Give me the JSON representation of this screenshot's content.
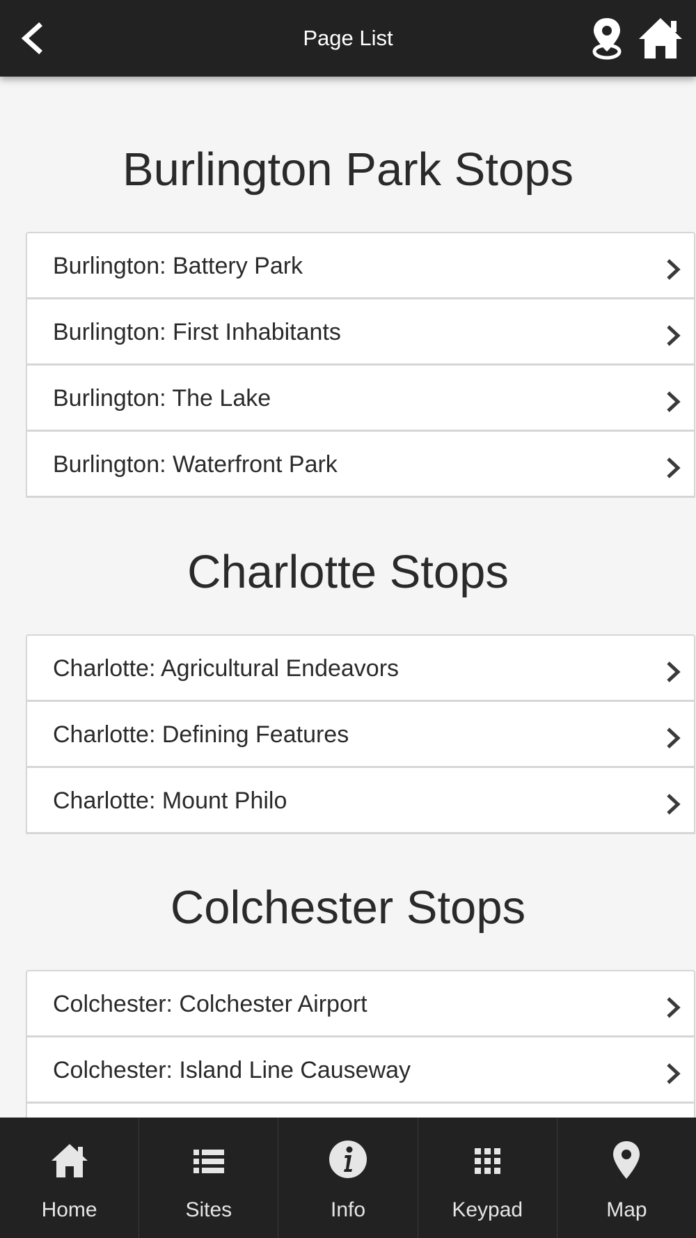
{
  "header": {
    "title": "Page List",
    "back_icon": "chevron-left-icon",
    "location_icon": "map-pin-icon",
    "home_icon": "home-icon"
  },
  "sections": [
    {
      "heading": "Burlington Park Stops",
      "items": [
        {
          "label": "Burlington: Battery Park"
        },
        {
          "label": "Burlington: First Inhabitants"
        },
        {
          "label": "Burlington: The Lake"
        },
        {
          "label": "Burlington: Waterfront Park"
        }
      ]
    },
    {
      "heading": "Charlotte Stops",
      "items": [
        {
          "label": "Charlotte: Agricultural Endeavors"
        },
        {
          "label": "Charlotte: Defining Features"
        },
        {
          "label": "Charlotte: Mount Philo"
        }
      ]
    },
    {
      "heading": "Colchester Stops",
      "items": [
        {
          "label": "Colchester: Colchester Airport"
        },
        {
          "label": "Colchester: Island Line Causeway"
        }
      ]
    }
  ],
  "tabbar": {
    "tabs": [
      {
        "label": "Home",
        "icon": "home-icon"
      },
      {
        "label": "Sites",
        "icon": "list-icon"
      },
      {
        "label": "Info",
        "icon": "info-icon"
      },
      {
        "label": "Keypad",
        "icon": "keypad-icon"
      },
      {
        "label": "Map",
        "icon": "map-pin-icon"
      }
    ]
  },
  "colors": {
    "bar_background": "#222222",
    "page_background": "#f5f5f5",
    "text": "#2a2a2a"
  }
}
